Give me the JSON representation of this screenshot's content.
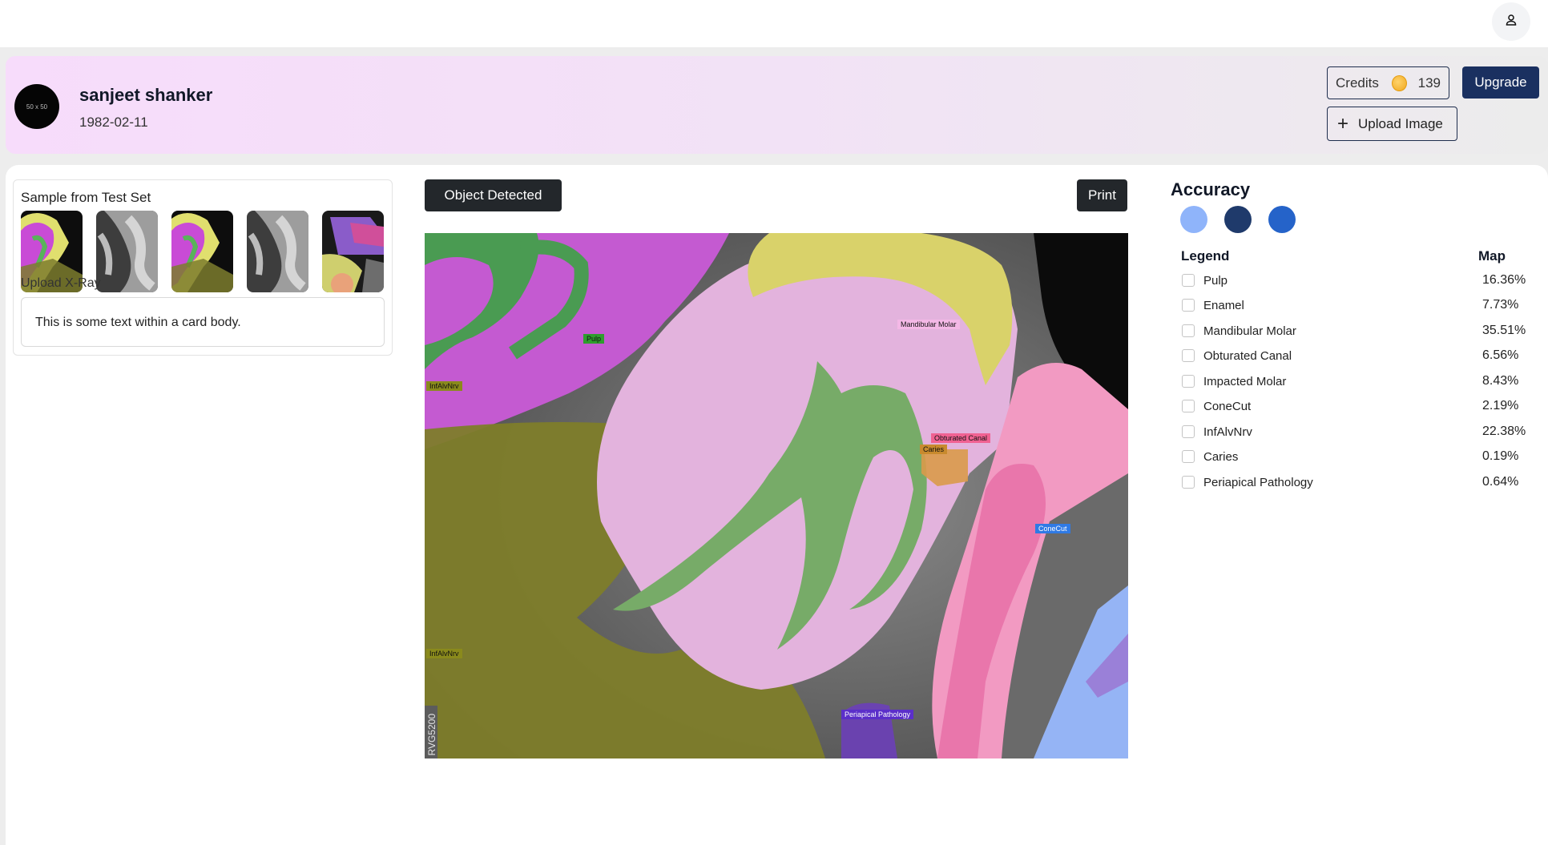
{
  "patient": {
    "avatar_text": "50 x 50",
    "name": "sanjeet shanker",
    "dob": "1982-02-11"
  },
  "credits": {
    "label": "Credits",
    "value": "139"
  },
  "buttons": {
    "upgrade": "Upgrade",
    "upload_image": "Upload Image",
    "object_detected": "Object Detected",
    "print": "Print"
  },
  "sample": {
    "title": "Sample from Test Set",
    "upload_label": "Upload X-Ray",
    "card_text": "This is some text within a card body."
  },
  "xray_tags": [
    {
      "label": "Pulp",
      "color": "#2e9e2e"
    },
    {
      "label": "InfAlvNrv",
      "color": "#8a8a1c"
    },
    {
      "label": "Mandibular Molar",
      "color": "#f4b8e6"
    },
    {
      "label": "Obturated Canal",
      "color": "#f06292"
    },
    {
      "label": "Caries",
      "color": "#c88a2e"
    },
    {
      "label": "ConeCut",
      "color": "#2f7ae5"
    },
    {
      "label": "InfAlvNrv",
      "color": "#8a8a1c"
    },
    {
      "label": "Periapical Pathology",
      "color": "#5b2fc9"
    }
  ],
  "xray_watermark": "RVG5200",
  "accuracy": {
    "title": "Accuracy",
    "colors": [
      "#8fb4fa",
      "#1f3a6b",
      "#2563c9"
    ]
  },
  "legend": {
    "header": "Legend",
    "map_header": "Map",
    "items": [
      {
        "label": "Pulp",
        "value": "16.36%"
      },
      {
        "label": "Enamel",
        "value": "7.73%"
      },
      {
        "label": "Mandibular Molar",
        "value": "35.51%"
      },
      {
        "label": "Obturated Canal",
        "value": "6.56%"
      },
      {
        "label": "Impacted Molar",
        "value": "8.43%"
      },
      {
        "label": "ConeCut",
        "value": "2.19%"
      },
      {
        "label": "InfAlvNrv",
        "value": "22.38%"
      },
      {
        "label": "Caries",
        "value": "0.19%"
      },
      {
        "label": "Periapical Pathology",
        "value": "0.64%"
      }
    ]
  }
}
